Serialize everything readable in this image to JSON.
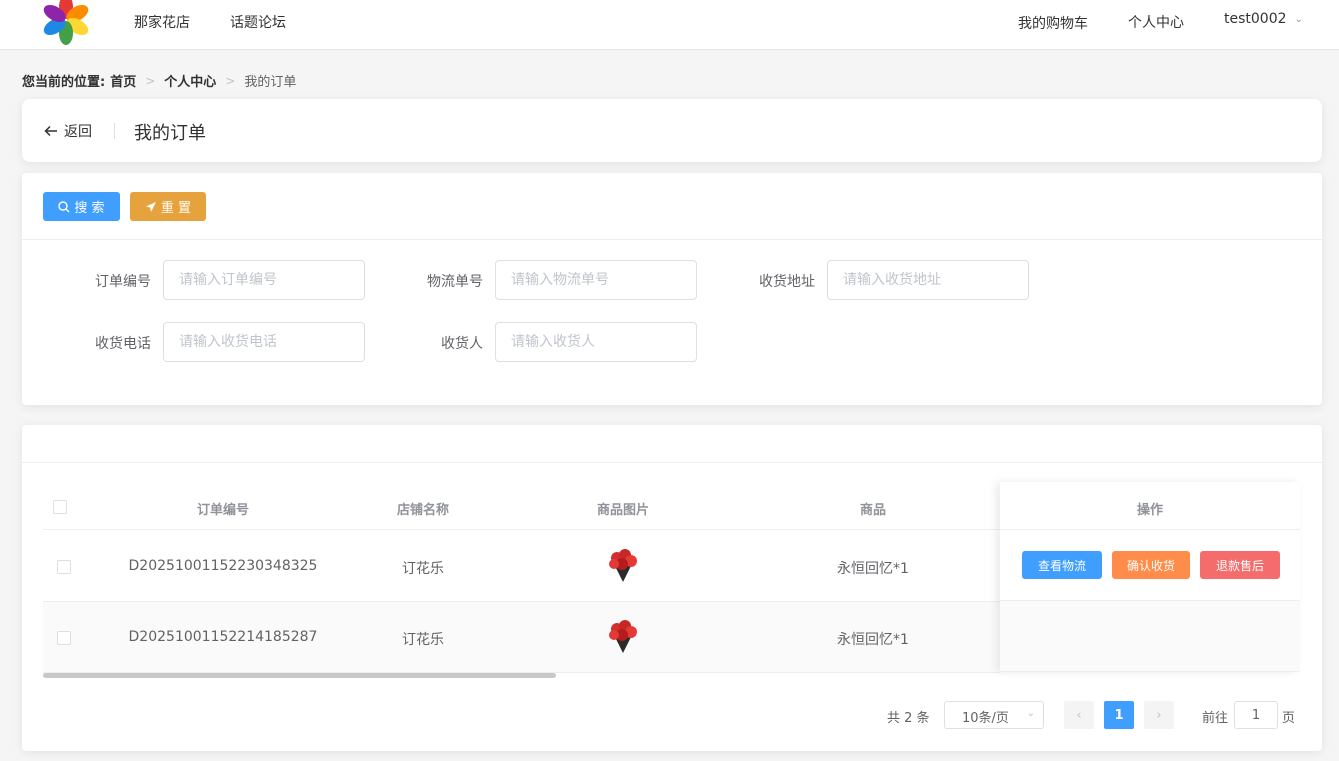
{
  "header": {
    "nav": [
      "那家花店",
      "话题论坛"
    ],
    "right_nav": [
      "我的购物车",
      "个人中心"
    ],
    "username": "test0002"
  },
  "breadcrumb": {
    "label": "您当前的位置:",
    "items": [
      "首页",
      "个人中心"
    ],
    "current": "我的订单"
  },
  "page_header": {
    "back_label": "返回",
    "title": "我的订单"
  },
  "toolbar": {
    "search_label": "搜 索",
    "reset_label": "重 置"
  },
  "filters": [
    {
      "label": "订单编号",
      "placeholder": "请输入订单编号"
    },
    {
      "label": "物流单号",
      "placeholder": "请输入物流单号"
    },
    {
      "label": "收货地址",
      "placeholder": "请输入收货地址"
    },
    {
      "label": "收货电话",
      "placeholder": "请输入收货电话"
    },
    {
      "label": "收货人",
      "placeholder": "请输入收货人"
    }
  ],
  "table": {
    "columns": [
      "订单编号",
      "店铺名称",
      "商品图片",
      "商品",
      "操作"
    ],
    "rows": [
      {
        "order_no": "D20251001152230348325",
        "shop": "订花乐",
        "product": "永恒回忆*1",
        "actions": [
          "查看物流",
          "确认收货",
          "退款售后"
        ]
      },
      {
        "order_no": "D20251001152214185287",
        "shop": "订花乐",
        "product": "永恒回忆*1",
        "actions": []
      }
    ],
    "action_colors": [
      "#409eff",
      "#ff8c4a",
      "#f56c6c"
    ]
  },
  "pagination": {
    "total": "共 2 条",
    "page_size": "10条/页",
    "current_page": "1",
    "goto_label": "前往",
    "goto_value": "1",
    "goto_unit": "页"
  }
}
